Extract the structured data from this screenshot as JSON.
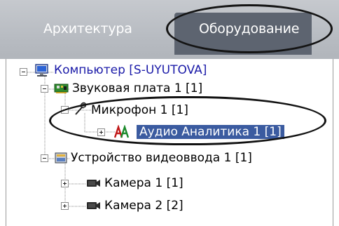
{
  "tabs": [
    {
      "label": "Архитектура",
      "active": false
    },
    {
      "label": "Оборудование",
      "active": true
    }
  ],
  "tree": {
    "computer": {
      "label": "Компьютер [S-UYUTOVA]",
      "icon": "computer-icon",
      "state": "expanded"
    },
    "sound_card": {
      "label": "Звуковая плата 1 [1]",
      "icon": "sound-card-icon",
      "state": "expanded"
    },
    "microphone": {
      "label": "Микрофон 1 [1]",
      "icon": "microphone-icon",
      "state": "expanded"
    },
    "audio_analytics": {
      "label": "Аудио Аналитика 1 [1]",
      "icon": "audio-analytics-icon",
      "state": "collapsed",
      "selected": true
    },
    "video_input": {
      "label": "Устройство видеоввода 1 [1]",
      "icon": "video-input-device-icon",
      "state": "expanded"
    },
    "camera1": {
      "label": "Камера 1 [1]",
      "icon": "camera-icon",
      "state": "collapsed"
    },
    "camera2": {
      "label": "Камера 2 [2]",
      "icon": "camera-icon",
      "state": "collapsed"
    }
  },
  "colors": {
    "selection": "#3b5ba0",
    "computer_label": "#1a1aa8",
    "active_tab": "#5d6470",
    "tab_bar": "#b8bcc2"
  }
}
